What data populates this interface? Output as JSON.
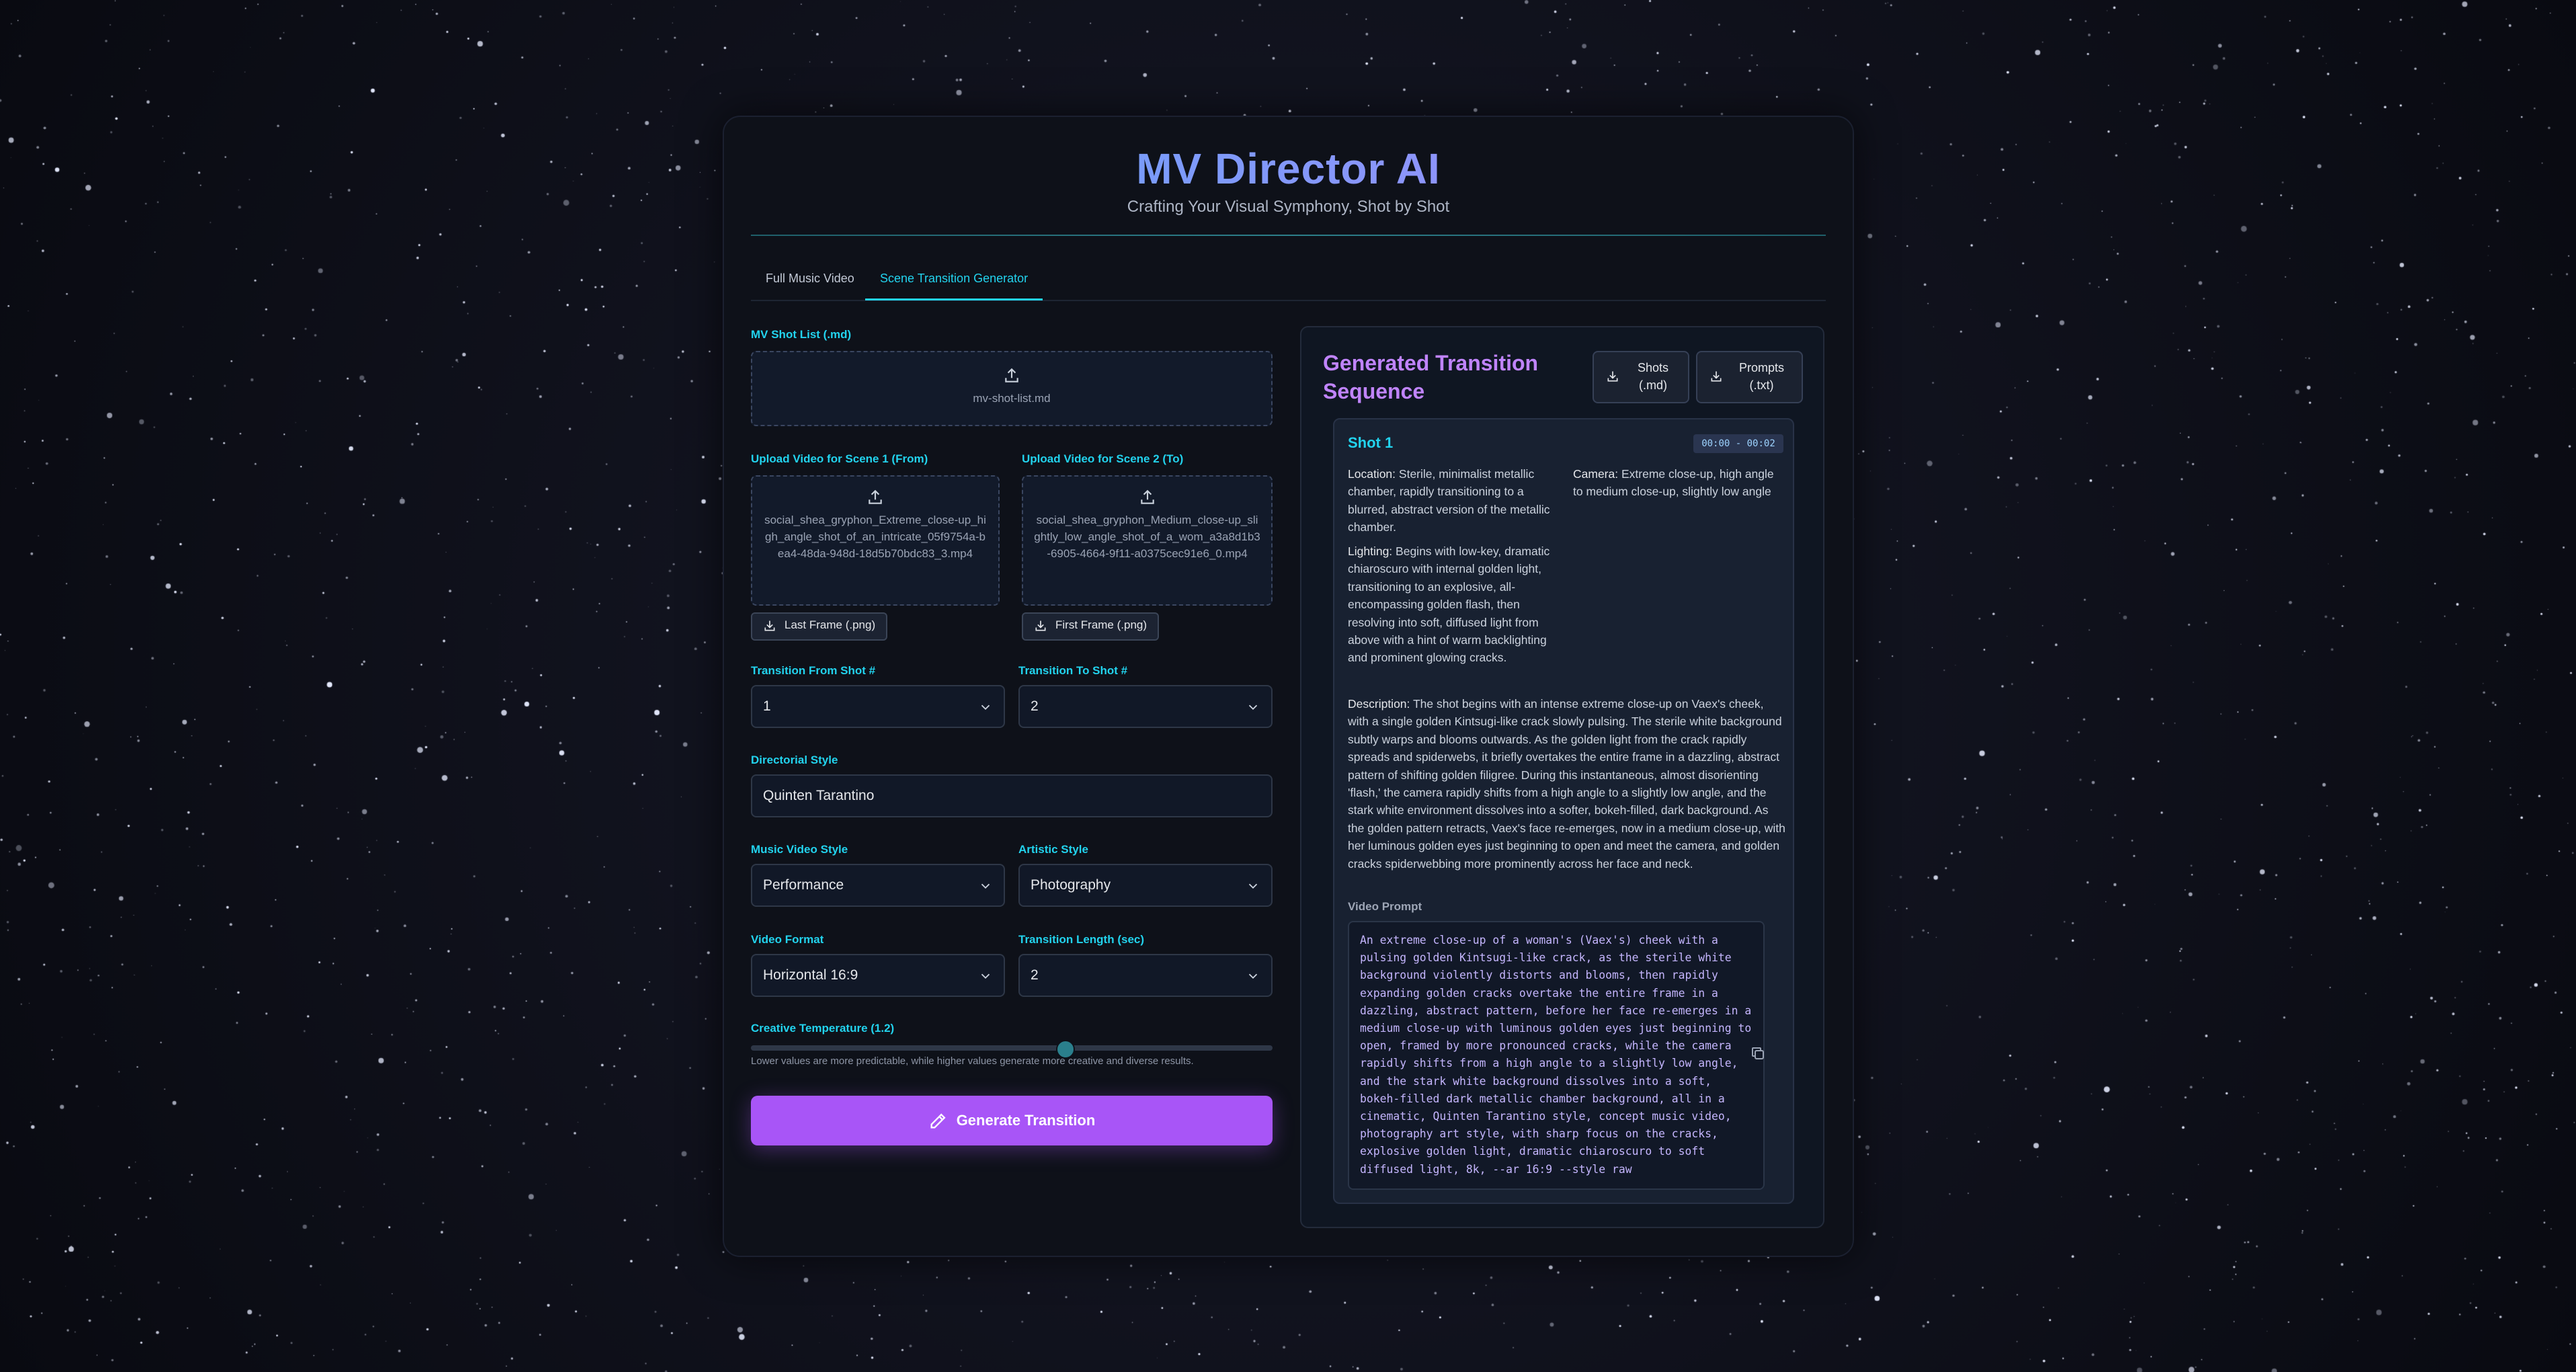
{
  "app": {
    "title": "MV Director AI",
    "subtitle": "Crafting Your Visual Symphony, Shot by Shot"
  },
  "tabs": [
    {
      "label": "Full Music Video",
      "active": false
    },
    {
      "label": "Scene Transition Generator",
      "active": true
    }
  ],
  "form": {
    "shot_list": {
      "label": "MV Shot List (.md)",
      "file": "mv-shot-list.md"
    },
    "scene1": {
      "label": "Upload Video for Scene 1 (From)",
      "file": "social_shea_gryphon_Extreme_close-up_high_angle_shot_of_an_intricate_05f9754a-bea4-48da-948d-18d5b70bdc83_3.mp4",
      "button": "Last Frame (.png)"
    },
    "scene2": {
      "label": "Upload Video for Scene 2 (To)",
      "file": "social_shea_gryphon_Medium_close-up_slightly_low_angle_shot_of_a_wom_a3a8d1b3-6905-4664-9f11-a0375cec91e6_0.mp4",
      "button": "First Frame (.png)"
    },
    "from_shot": {
      "label": "Transition From Shot #",
      "value": "1"
    },
    "to_shot": {
      "label": "Transition To Shot #",
      "value": "2"
    },
    "directorial_style": {
      "label": "Directorial Style",
      "value": "Quinten Tarantino"
    },
    "music_video_style": {
      "label": "Music Video Style",
      "value": "Performance"
    },
    "artistic_style": {
      "label": "Artistic Style",
      "value": "Photography"
    },
    "video_format": {
      "label": "Video Format",
      "value": "Horizontal 16:9"
    },
    "transition_length": {
      "label": "Transition Length (sec)",
      "value": "2"
    },
    "temperature": {
      "label": "Creative Temperature (1.2)",
      "value": 1.2,
      "fraction": 0.6,
      "help": "Lower values are more predictable, while higher values generate more creative and diverse results."
    },
    "generate_button": "Generate Transition"
  },
  "result": {
    "title": "Generated Transition Sequence",
    "download_shots": "Shots (.md)",
    "download_prompts": "Prompts (.txt)",
    "shot": {
      "title": "Shot 1",
      "timecode": "00:00 - 00:02",
      "location_key": "Location:",
      "location": "Sterile, minimalist metallic chamber, rapidly transitioning to a blurred, abstract version of the metallic chamber.",
      "camera_key": "Camera:",
      "camera": "Extreme close-up, high angle to medium close-up, slightly low angle",
      "lighting_key": "Lighting:",
      "lighting": "Begins with low-key, dramatic chiaroscuro with internal golden light, transitioning to an explosive, all-encompassing golden flash, then resolving into soft, diffused light from above with a hint of warm backlighting and prominent glowing cracks.",
      "description_key": "Description:",
      "description": "The shot begins with an intense extreme close-up on Vaex's cheek, with a single golden Kintsugi-like crack slowly pulsing. The sterile white background subtly warps and blooms outwards. As the golden light from the crack rapidly spreads and spiderwebs, it briefly overtakes the entire frame in a dazzling, abstract pattern of shifting golden filigree. During this instantaneous, almost disorienting 'flash,' the camera rapidly shifts from a high angle to a slightly low angle, and the stark white environment dissolves into a softer, bokeh-filled, dark background. As the golden pattern retracts, Vaex's face re-emerges, now in a medium close-up, with her luminous golden eyes just beginning to open and meet the camera, and golden cracks spiderwebbing more prominently across her face and neck.",
      "video_prompt_label": "Video Prompt",
      "video_prompt": "An extreme close-up of a woman's (Vaex's) cheek with a pulsing golden Kintsugi-like crack, as the sterile white background violently distorts and blooms, then rapidly expanding golden cracks overtake the entire frame in a dazzling, abstract pattern, before her face re-emerges in a medium close-up with luminous golden eyes just beginning to open, framed by more pronounced cracks, while the camera rapidly shifts from a high angle to a slightly low angle, and the stark white background dissolves into a soft, bokeh-filled dark metallic chamber background, all in a cinematic, Quinten Tarantino style, concept music video, photography art style, with sharp focus on the cracks, explosive golden light, dramatic chiaroscuro to soft diffused light, 8k, --ar 16:9 --style raw"
    }
  },
  "icons": {
    "upload": "upload-icon",
    "download": "download-icon",
    "chevron": "chevron-down-icon",
    "pencil": "pencil-icon",
    "copy": "copy-icon"
  },
  "colors": {
    "accent_cyan": "#22d3ee",
    "accent_purple": "#a855f7",
    "title_purple": "#c084fc",
    "panel_bg": "#0e1119"
  }
}
